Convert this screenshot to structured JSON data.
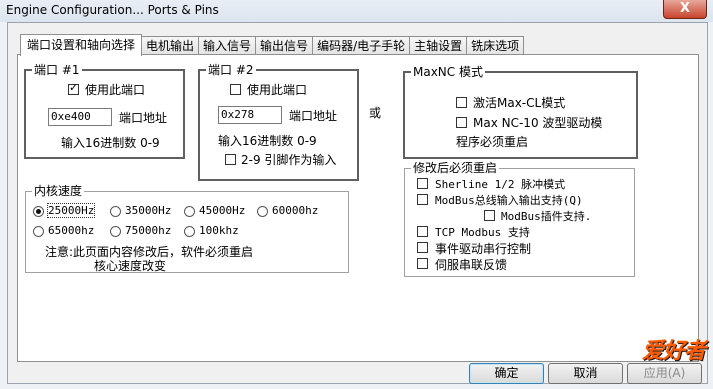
{
  "window": {
    "title": "Engine Configuration... Ports & Pins",
    "close_glyph": "X"
  },
  "tabs": [
    "端口设置和轴向选择",
    "电机输出",
    "输入信号",
    "输出信号",
    "编码器/电子手轮",
    "主轴设置",
    "铣床选项"
  ],
  "port1": {
    "legend": "端口 #1",
    "enable_label": "使用此端口",
    "enabled": true,
    "address_value": "0xe400",
    "address_label": "端口地址",
    "hex_hint": "输入16进制数 0-9"
  },
  "or_label": "或",
  "port2": {
    "legend": "端口 #2",
    "enable_label": "使用此端口",
    "enabled": false,
    "address_value": "0x278",
    "address_label": "端口地址",
    "hex_hint": "输入16进制数 0-9",
    "pins_label": "2-9 引脚作为输入"
  },
  "maxnc": {
    "legend": "MaxNC 模式",
    "option1": "激活Max-CL模式",
    "option2": "Max NC-10 波型驱动模",
    "restart_note": "程序必须重启"
  },
  "restart_group": {
    "legend": "修改后必须重启",
    "options": [
      "Sherline 1/2 脉冲模式",
      "ModBus总线输入输出支持(Q)",
      "ModBus插件支持.",
      "TCP Modbus 支持",
      "事件驱动串行控制",
      "伺服串联反馈"
    ]
  },
  "kernel": {
    "legend": "内核速度",
    "options": [
      "25000Hz",
      "35000Hz",
      "45000Hz",
      "60000hz",
      "65000hz",
      "75000hz",
      "100khz"
    ],
    "selected": "25000Hz",
    "note_line1": "注意:此页面内容修改后，软件必须重启",
    "note_line2": "核心速度改变"
  },
  "buttons": {
    "ok": "确定",
    "cancel": "取消",
    "apply": "应用(A)"
  },
  "watermark": "爱好者"
}
